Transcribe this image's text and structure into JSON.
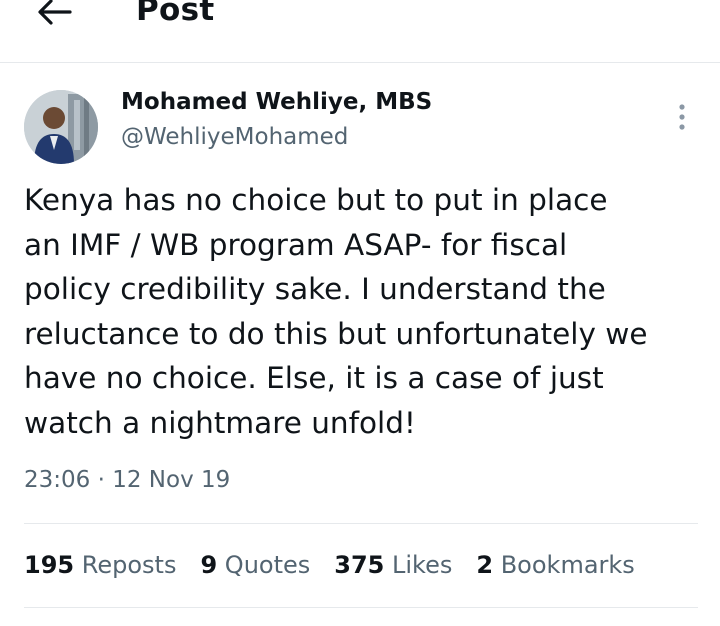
{
  "header": {
    "title": "Post",
    "back_icon": "arrow-left-icon"
  },
  "author": {
    "name": "Mohamed Wehliye, MBS",
    "handle": "@WehliyeMohamed",
    "avatar": "profile-photo"
  },
  "tweet": {
    "text": "Kenya has no choice but to put in place\nan IMF / WB program ASAP- for fiscal\npolicy credibility sake. I understand the\nreluctance to do this but unfortunately we\nhave no choice. Else, it is a case of just\nwatch a nightmare unfold!",
    "time": "23:06",
    "separator": "·",
    "date": "12 Nov 19"
  },
  "stats": {
    "reposts": {
      "count": "195",
      "label": "Reposts"
    },
    "quotes": {
      "count": "9",
      "label": "Quotes"
    },
    "likes": {
      "count": "375",
      "label": "Likes"
    },
    "bookmarks": {
      "count": "2",
      "label": "Bookmarks"
    }
  },
  "colors": {
    "text_primary": "#0f1419",
    "text_secondary": "#536471",
    "divider": "#e6e9ec",
    "background": "#ffffff"
  }
}
